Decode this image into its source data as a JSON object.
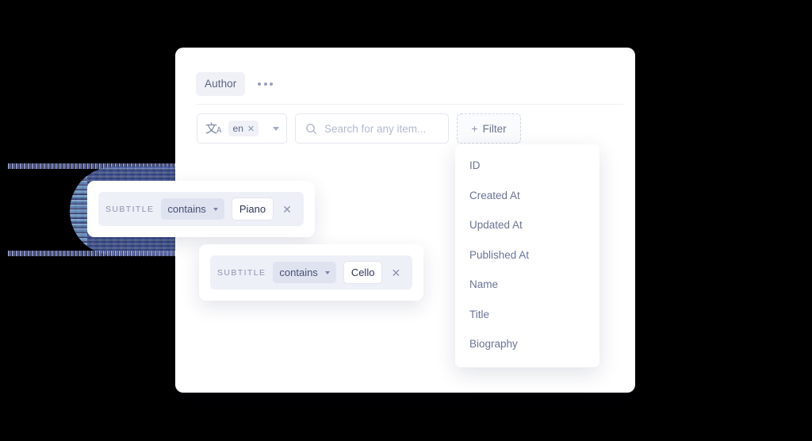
{
  "card": {
    "tabs": [
      {
        "label": "Author",
        "name": "tab-author"
      }
    ],
    "overflow_icon": "ellipsis-icon"
  },
  "controls": {
    "language_select": {
      "icon": "translate-icon",
      "glyph": "文",
      "glyph_sub": "A",
      "selected_tag": "en",
      "remove_glyph": "✕",
      "caret_icon": "chevron-down-icon"
    },
    "search": {
      "icon": "search-icon",
      "placeholder": "Search for any item...",
      "value": ""
    },
    "filter_button": {
      "plus_glyph": "+",
      "label": "Filter"
    }
  },
  "field_dropdown": {
    "items": [
      {
        "label": "ID"
      },
      {
        "label": "Created At"
      },
      {
        "label": "Updated At"
      },
      {
        "label": "Published At"
      },
      {
        "label": "Name"
      },
      {
        "label": "Title"
      },
      {
        "label": "Biography"
      }
    ]
  },
  "filter_chips": [
    {
      "field": "SUBTITLE",
      "operator": "contains",
      "value": "Piano",
      "remove_glyph": "✕"
    },
    {
      "field": "SUBTITLE",
      "operator": "contains",
      "value": "Cello",
      "remove_glyph": "✕"
    }
  ],
  "colors": {
    "background": "#000000",
    "card": "#ffffff",
    "chip_bg": "#eef0f7",
    "operator_bg": "#dfe3f0",
    "text_muted": "#8a92b2",
    "text_primary": "#474f73",
    "accent_border": "#cfd4e4"
  }
}
